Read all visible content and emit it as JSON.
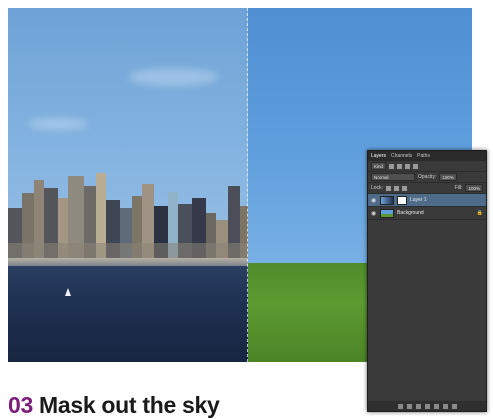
{
  "caption": {
    "number": "03",
    "text": "Mask out the sky"
  },
  "layers_panel": {
    "tabs": [
      "Layers",
      "Channels",
      "Paths"
    ],
    "kind_filter": "Kind",
    "blend_mode": "Normal",
    "opacity_label": "Opacity:",
    "opacity_value": "100%",
    "lock_label": "Lock:",
    "fill_label": "Fill:",
    "fill_value": "100%",
    "layers": [
      {
        "name": "Layer 1",
        "selected": true,
        "has_mask": true
      },
      {
        "name": "Background",
        "selected": false,
        "locked": true
      }
    ]
  },
  "colors": {
    "caption_number": "#7b1e7b",
    "selected_layer": "#4f6b8a"
  }
}
